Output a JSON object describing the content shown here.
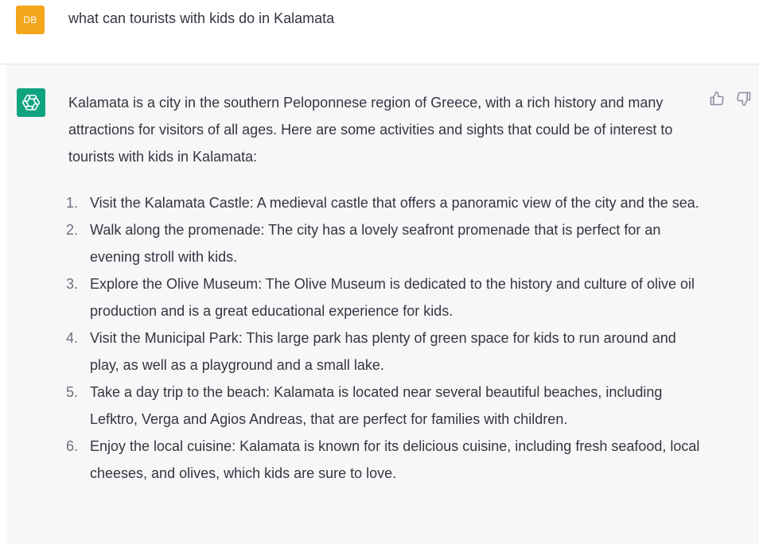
{
  "user_message": {
    "avatar_initials": "DB",
    "avatar_color": "#f4a51c",
    "text": "what can tourists with kids do in Kalamata"
  },
  "assistant_message": {
    "avatar_icon": "openai-logo-icon",
    "avatar_color": "#10a37f",
    "intro": "Kalamata is a city in the southern Peloponnese region of Greece, with a rich history and many attractions for visitors of all ages. Here are some activities and sights that could be of interest to tourists with kids in Kalamata:",
    "items": [
      {
        "number": "1.",
        "text": "Visit the Kalamata Castle: A medieval castle that offers a panoramic view of the city and the sea."
      },
      {
        "number": "2.",
        "text": "Walk along the promenade: The city has a lovely seafront promenade that is perfect for an evening stroll with kids."
      },
      {
        "number": "3.",
        "text": "Explore the Olive Museum: The Olive Museum is dedicated to the history and culture of olive oil production and is a great educational experience for kids."
      },
      {
        "number": "4.",
        "text": "Visit the Municipal Park: This large park has plenty of green space for kids to run around and play, as well as a playground and a small lake."
      },
      {
        "number": "5.",
        "text": "Take a day trip to the beach: Kalamata is located near several beautiful beaches, including Lefktro, Verga and Agios Andreas, that are perfect for families with children."
      },
      {
        "number": "6.",
        "text": "Enjoy the local cuisine: Kalamata is known for its delicious cuisine, including fresh seafood, local cheeses, and olives, which kids are sure to love."
      }
    ],
    "feedback_icons": [
      "thumbs-up-icon",
      "thumbs-down-icon"
    ]
  }
}
